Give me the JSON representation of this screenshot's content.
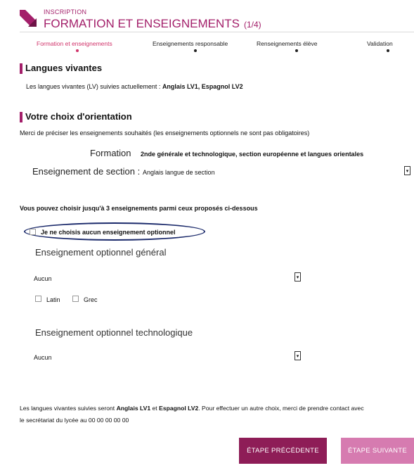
{
  "header": {
    "kicker": "INSCRIPTION",
    "title": "FORMATION ET ENSEIGNEMENTS",
    "pager": "(1/4)"
  },
  "steps": [
    {
      "label": "Formation et enseignements",
      "active": true
    },
    {
      "label": "Enseignements responsable",
      "active": false
    },
    {
      "label": "Renseignements élève",
      "active": false
    },
    {
      "label": "Validation",
      "active": false
    }
  ],
  "languages": {
    "title": "Langues vivantes",
    "text_prefix": "Les langues vivantes (LV) suivies actuellement : ",
    "text_value": "Anglais LV1, Espagnol LV2"
  },
  "orientation": {
    "title": "Votre choix d'orientation",
    "intro": "Merci de préciser les enseignements souhaités (les enseignements optionnels ne sont pas obligatoires)",
    "formation_label": "Formation",
    "formation_value": "2nde générale et technologique, section européenne et langues orientales",
    "section_label": "Enseignement de section :",
    "section_value": "Anglais langue de section",
    "choose_text": "Vous pouvez choisir jusqu'à 3 enseignements parmi ceux proposés ci-dessous",
    "no_option_label": "Je ne choisis aucun enseignement optionnel",
    "general": {
      "heading": "Enseignement optionnel général",
      "selected": "Aucun",
      "checkboxes": [
        "Latin",
        "Grec"
      ]
    },
    "technological": {
      "heading": "Enseignement optionnel technologique",
      "selected": "Aucun"
    }
  },
  "footer": {
    "line1_a": "Les langues vivantes suivies seront ",
    "line1_b": "Anglais LV1",
    "line1_c": " et ",
    "line1_d": "Espagnol LV2",
    "line1_e": ". Pour effectuer un autre choix, merci de prendre contact avec",
    "line2": "le secrétariat du lycée au 00 00 00 00 00"
  },
  "buttons": {
    "prev": "ÉTAPE PRÉCÉDENTE",
    "next": "ÉTAPE SUIVANTE"
  },
  "colors": {
    "accent": "#a31f6a",
    "active_step": "#d0336a",
    "oval": "#1b2a6b",
    "btn_prev": "#8e1d57",
    "btn_next": "#d67bb0"
  }
}
